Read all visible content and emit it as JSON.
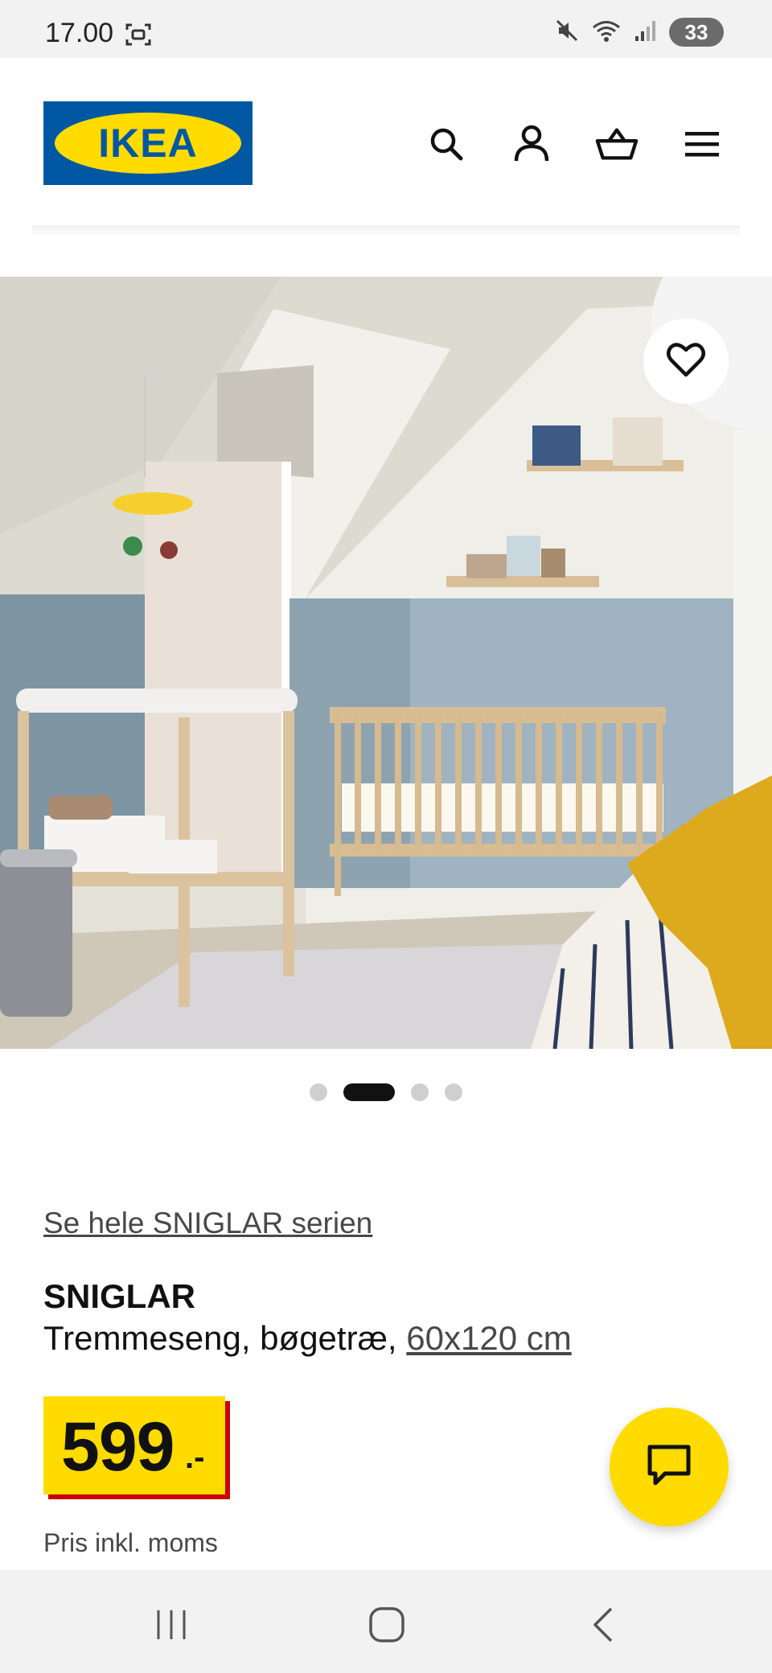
{
  "status_bar": {
    "time": "17.00",
    "battery": "33",
    "icons": [
      "screenshot-icon",
      "mute-icon",
      "wifi-icon",
      "signal-icon"
    ]
  },
  "header": {
    "logo_text": "IKEA",
    "icons": [
      "search-icon",
      "account-icon",
      "cart-icon",
      "menu-icon"
    ],
    "brand_colors": {
      "blue": "#0058a3",
      "yellow": "#ffdb00"
    }
  },
  "hero": {
    "favorite_icon": "heart-outline-icon",
    "carousel": {
      "count": 4,
      "active_index": 1
    }
  },
  "product": {
    "series_link": "Se hele SNIGLAR serien",
    "name": "SNIGLAR",
    "description": "Tremmeseng, bøgetræ, ",
    "size_link": "60x120 cm",
    "price_integer": "599",
    "price_suffix": ".-",
    "price_note": "Pris inkl. moms"
  },
  "chat": {
    "icon": "chat-icon"
  },
  "navigation_bar": {
    "buttons": [
      "recents-icon",
      "home-icon",
      "back-icon"
    ]
  }
}
